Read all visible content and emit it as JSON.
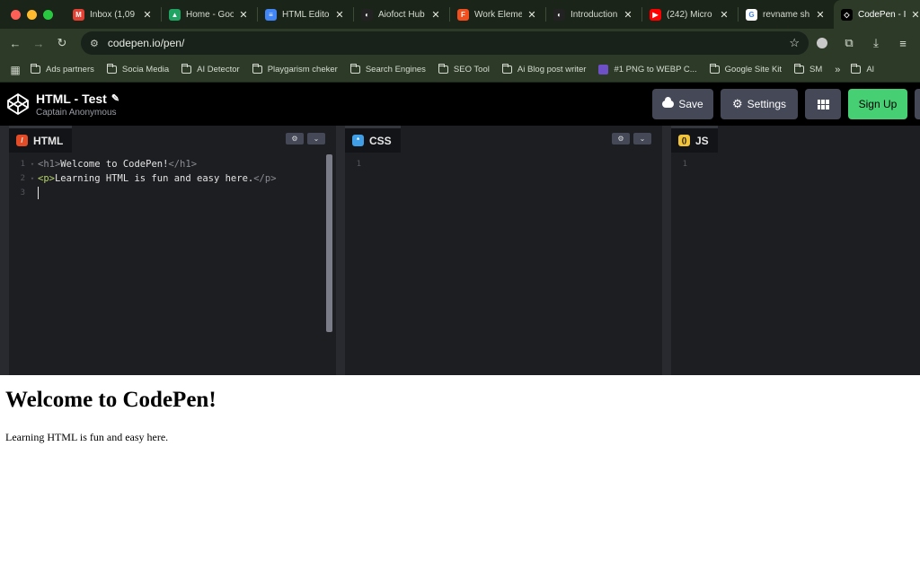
{
  "browser": {
    "traffic_colors": [
      "#ff5f57",
      "#febc2e",
      "#28c840"
    ],
    "tabs": [
      {
        "label": "Inbox (1,09",
        "icon": "gmail-icon",
        "fav_color": "#e44134",
        "fav_text": "M"
      },
      {
        "label": "Home - Goo",
        "icon": "drive-icon",
        "fav_color": "#1fa463",
        "fav_text": "▲"
      },
      {
        "label": "HTML Edito",
        "icon": "docs-icon",
        "fav_color": "#4285f4",
        "fav_text": "≡"
      },
      {
        "label": "Aiofoct Hub",
        "icon": "aiofoct-icon",
        "fav_color": "#222222",
        "fav_text": "◐"
      },
      {
        "label": "Work Eleme",
        "icon": "figma-icon",
        "fav_color": "#f24e1e",
        "fav_text": "F"
      },
      {
        "label": "Introduction",
        "icon": "aiofoct-icon",
        "fav_color": "#222222",
        "fav_text": "◐"
      },
      {
        "label": "(242) Micro",
        "icon": "youtube-icon",
        "fav_color": "#ff0000",
        "fav_text": "▶"
      },
      {
        "label": "revname sh",
        "icon": "google-icon",
        "fav_color": "#ffffff",
        "fav_text": "G"
      },
      {
        "label": "CodePen - I",
        "icon": "codepen-icon",
        "fav_color": "#000000",
        "fav_text": "◇",
        "active": true
      }
    ],
    "close_glyph": "✕",
    "new_tab_glyph": "+",
    "url": "codepen.io/pen/",
    "bookmarks": [
      {
        "label": "Ads partners",
        "type": "folder"
      },
      {
        "label": "Socia Media",
        "type": "folder"
      },
      {
        "label": "AI Detector",
        "type": "folder"
      },
      {
        "label": "Playgarism cheker",
        "type": "folder"
      },
      {
        "label": "Search Engines",
        "type": "folder"
      },
      {
        "label": "SEO Tool",
        "type": "folder"
      },
      {
        "label": "Ai Blog post writer",
        "type": "folder"
      },
      {
        "label": "#1 PNG to WEBP C...",
        "type": "site"
      },
      {
        "label": "Google Site Kit",
        "type": "folder"
      },
      {
        "label": "SM",
        "type": "folder"
      }
    ],
    "bookmarks_more": "»",
    "bookmarks_last": "Al"
  },
  "codepen": {
    "title": "HTML - Test",
    "author": "Captain Anonymous",
    "buttons": {
      "save": "Save",
      "settings": "Settings",
      "signup": "Sign Up"
    },
    "panes": [
      {
        "id": "html",
        "label": "HTML",
        "color": "#e34c26",
        "glyph": "/"
      },
      {
        "id": "css",
        "label": "CSS",
        "color": "#3f9ee5",
        "glyph": "*"
      },
      {
        "id": "js",
        "label": "JS",
        "color": "#f2c43a",
        "glyph": "()"
      }
    ],
    "html_code": {
      "line1_open": "<h1>",
      "line1_text": "Welcome to CodePen!",
      "line1_close": "</h1>",
      "line2_open": "<p>",
      "line2_text": "Learning HTML is fun and easy here.",
      "line2_close": "</p>"
    },
    "line_numbers": [
      "1",
      "2",
      "3"
    ]
  },
  "preview": {
    "heading": "Welcome to CodePen!",
    "paragraph": "Learning HTML is fun and easy here."
  }
}
